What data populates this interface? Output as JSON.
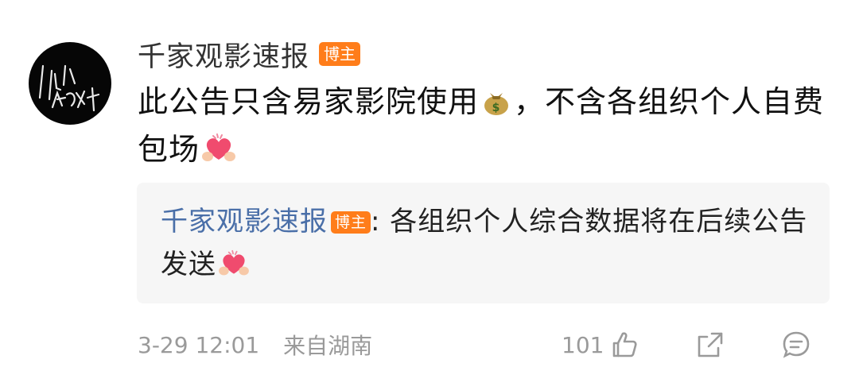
{
  "author": {
    "name": "千家观影速报",
    "badge": "博主"
  },
  "post": {
    "text_part1": "此公告只含易家影院使用",
    "text_part2": "，不含各组织个人自费包场"
  },
  "quote": {
    "author": "千家观影速报",
    "badge": "博主",
    "text": ": 各组织个人综合数据将在后续公告发送"
  },
  "footer": {
    "time": "3-29 12:01",
    "location": "来自湖南"
  },
  "actions": {
    "like_count": "101"
  },
  "icons": {
    "money": "money-bag-icon",
    "heart": "heart-hands-icon",
    "like": "thumbs-up-icon",
    "share": "share-icon",
    "comment": "comment-icon"
  },
  "colors": {
    "badge": "#ff7d1a",
    "quote_author": "#4a6fa8",
    "meta": "#9a9a9a"
  }
}
